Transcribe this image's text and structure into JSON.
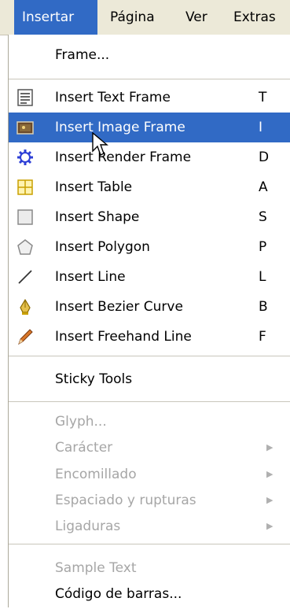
{
  "menubar": {
    "items": [
      {
        "label": "Insertar"
      },
      {
        "label": "Página"
      },
      {
        "label": "Ver"
      },
      {
        "label": "Extras"
      }
    ]
  },
  "menu": {
    "frame": {
      "label": "Frame..."
    },
    "tools": [
      {
        "label": "Insert Text Frame",
        "shortcut": "T",
        "icon": "text-frame-icon"
      },
      {
        "label": "Insert Image Frame",
        "shortcut": "I",
        "icon": "image-frame-icon"
      },
      {
        "label": "Insert Render Frame",
        "shortcut": "D",
        "icon": "render-frame-icon"
      },
      {
        "label": "Insert Table",
        "shortcut": "A",
        "icon": "table-icon"
      },
      {
        "label": "Insert Shape",
        "shortcut": "S",
        "icon": "shape-icon"
      },
      {
        "label": "Insert Polygon",
        "shortcut": "P",
        "icon": "polygon-icon"
      },
      {
        "label": "Insert Line",
        "shortcut": "L",
        "icon": "line-icon"
      },
      {
        "label": "Insert Bezier Curve",
        "shortcut": "B",
        "icon": "bezier-pen-icon"
      },
      {
        "label": "Insert Freehand Line",
        "shortcut": "F",
        "icon": "pencil-icon"
      }
    ],
    "sticky": {
      "label": "Sticky Tools"
    },
    "text_items": [
      {
        "label": "Glyph..."
      },
      {
        "label": "Carácter"
      },
      {
        "label": "Encomillado"
      },
      {
        "label": "Espaciado y rupturas"
      },
      {
        "label": "Ligaduras"
      }
    ],
    "bottom": [
      {
        "label": "Sample Text"
      },
      {
        "label": "Código de barras..."
      }
    ],
    "highlighted_index": 1,
    "colors": {
      "highlight": "#316ac5",
      "disabled_text": "#a6a6a6",
      "menubar": "#ece9d8"
    }
  }
}
